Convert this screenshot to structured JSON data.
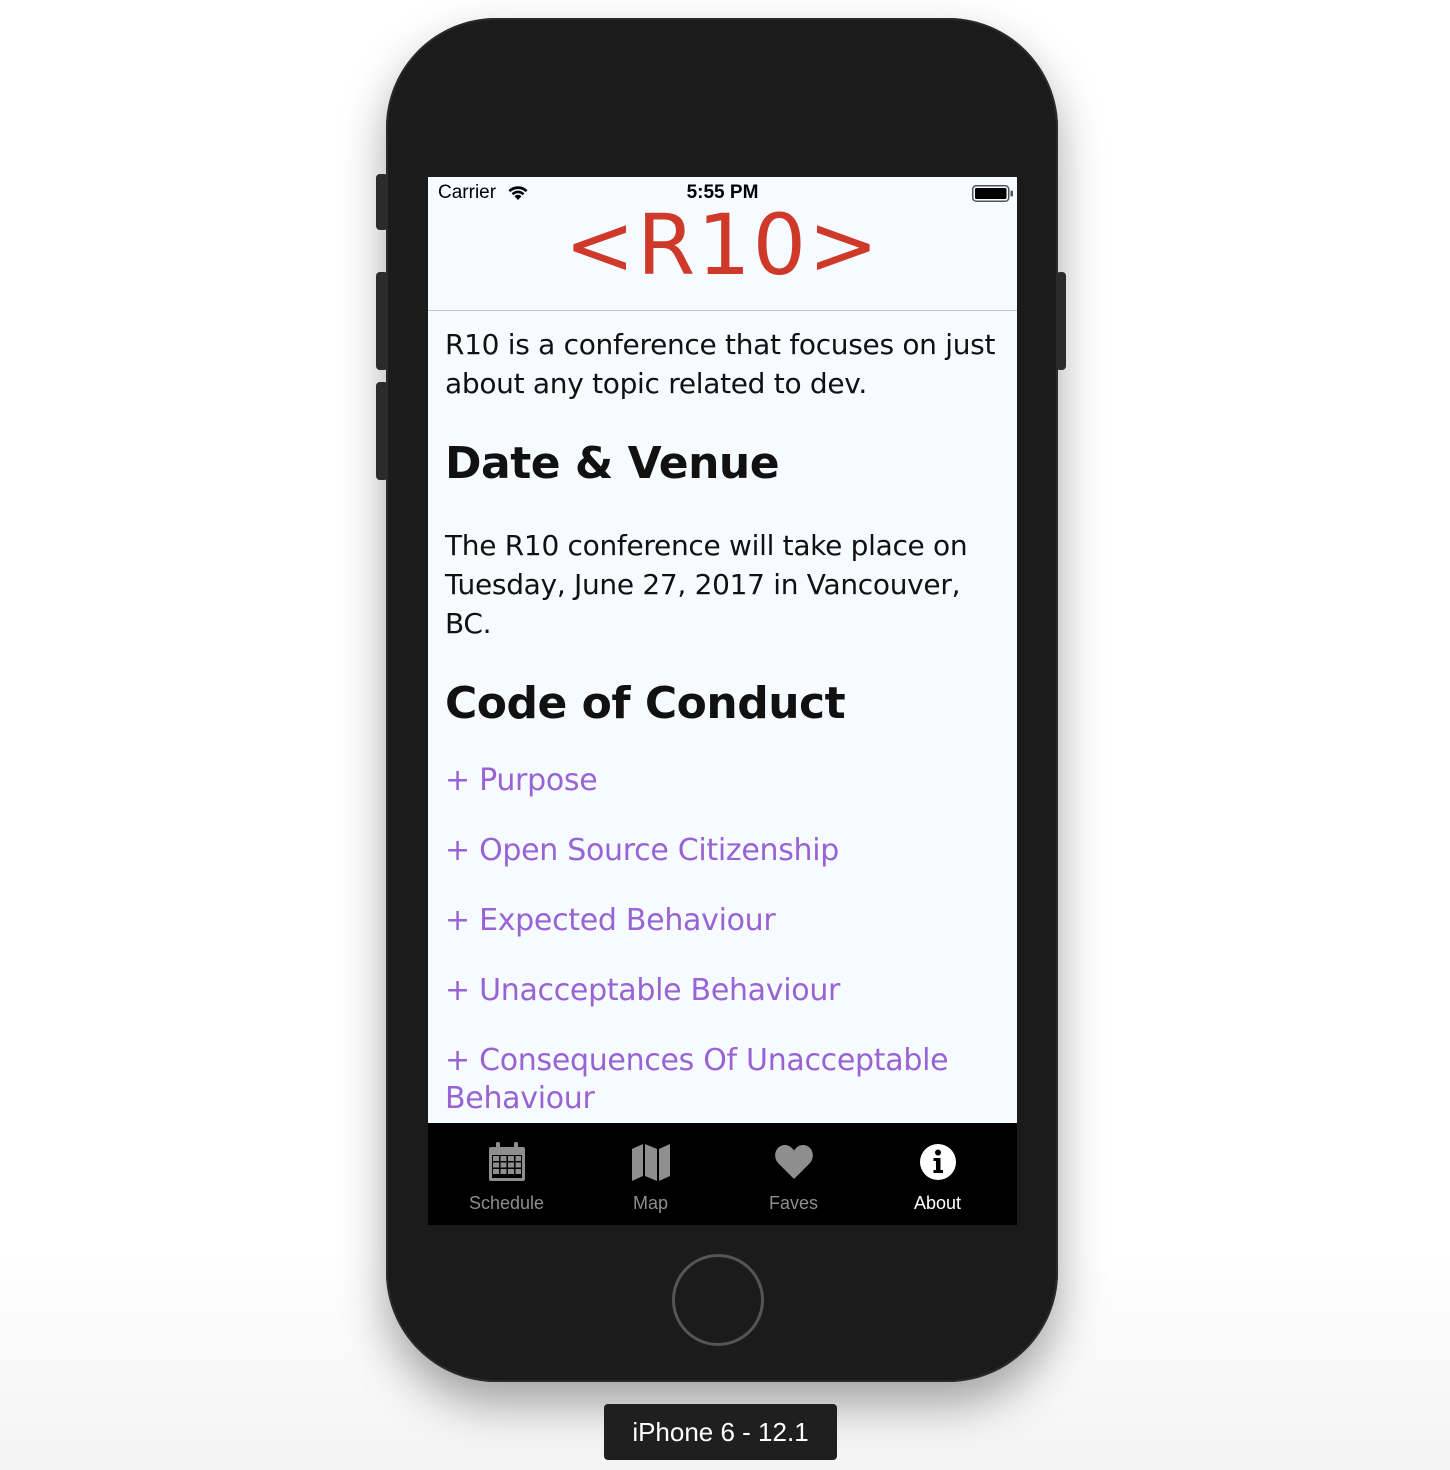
{
  "status_bar": {
    "carrier": "Carrier",
    "time": "5:55 PM"
  },
  "header": {
    "logo_text": "<R10>",
    "logo_color": "#cf392a"
  },
  "about": {
    "intro": "R10 is a conference that focuses on just about any topic related to dev.",
    "date_venue_heading": "Date & Venue",
    "date_venue_text": "The R10 conference will take place on Tuesday, June 27, 2017 in Vancouver, BC.",
    "code_of_conduct_heading": "Code of Conduct",
    "code_of_conduct_items": [
      "+ Purpose",
      "+ Open Source Citizenship",
      "+ Expected Behaviour",
      "+ Unacceptable Behaviour",
      "+ Consequences Of Unacceptable Behaviour"
    ],
    "link_color": "#9963d5"
  },
  "tab_bar": {
    "tabs": [
      {
        "label": "Schedule",
        "icon": "calendar-icon",
        "active": false
      },
      {
        "label": "Map",
        "icon": "map-icon",
        "active": false
      },
      {
        "label": "Faves",
        "icon": "heart-icon",
        "active": false
      },
      {
        "label": "About",
        "icon": "info-icon",
        "active": true
      }
    ]
  },
  "simulator": {
    "device_label": "iPhone 6 - 12.1"
  }
}
